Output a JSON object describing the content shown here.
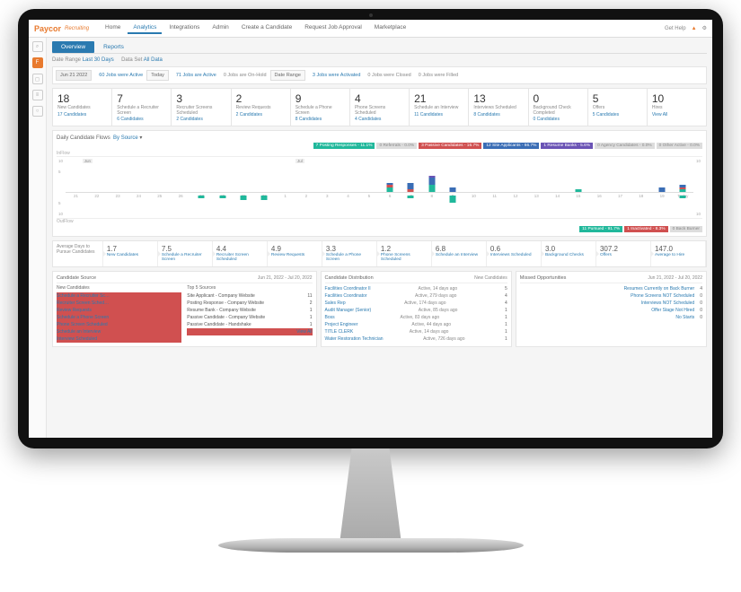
{
  "brand": {
    "name": "Paycor",
    "sub": "Recruiting"
  },
  "nav": [
    "Home",
    "Analytics",
    "Integrations",
    "Admin",
    "Create a Candidate",
    "Request Job Approval",
    "Marketplace"
  ],
  "nav_active": 1,
  "header_right": {
    "help": "Get Help"
  },
  "tabs": {
    "overview": "Overview",
    "reports": "Reports"
  },
  "filters": {
    "date_range_label": "Date Range",
    "date_range_value": "Last 30 Days",
    "data_set_label": "Data Set",
    "data_set_value": "All Data"
  },
  "date_row": {
    "date_btn": "Jun 21 2022",
    "stat1": "60 Jobs were Active",
    "today_btn": "Today",
    "stat2": "71 Jobs are Active",
    "stat3": "0 Jobs are On-Hold",
    "range_btn": "Date Range",
    "stat4": "3 Jobs were Activated",
    "stat5": "0 Jobs were Closed",
    "stat6": "0 Jobs were Filled"
  },
  "kpis": [
    {
      "n": "18",
      "l": "New Candidates",
      "s": "17 Candidates"
    },
    {
      "n": "7",
      "l": "Schedule a Recruiter Screen",
      "s": "6 Candidates"
    },
    {
      "n": "3",
      "l": "Recruiter Screens Scheduled",
      "s": "2 Candidates"
    },
    {
      "n": "2",
      "l": "Review Requests",
      "s": "2 Candidates"
    },
    {
      "n": "9",
      "l": "Schedule a Phone Screen",
      "s": "8 Candidates"
    },
    {
      "n": "4",
      "l": "Phone Screens Scheduled",
      "s": "4 Candidates"
    },
    {
      "n": "21",
      "l": "Schedule an Interview",
      "s": "11 Candidates"
    },
    {
      "n": "13",
      "l": "Interviews Scheduled",
      "s": "8 Candidates"
    },
    {
      "n": "0",
      "l": "Background Check Completed",
      "s": "0 Candidates"
    },
    {
      "n": "5",
      "l": "Offers",
      "s": "5 Candidates"
    },
    {
      "n": "10",
      "l": "Hires",
      "s": "View All"
    }
  ],
  "chart": {
    "title": "Daily Candidate Flows",
    "subtitle": "By Source",
    "inflow": "InFlow",
    "outflow": "OutFlow",
    "legend": [
      "7 Posting Responses - 11.1%",
      "0 Referrals - 0.0%",
      "3 Passive Candidates - 16.7%",
      "12 Site Applicants - 66.7%",
      "1 Resume Banks - 5.6%",
      "0 Agency Candidates - 0.0%",
      "0 Other Active - 0.0%"
    ],
    "legend2": [
      "11 Pursued - 91.7%",
      "1 Inactivated - 8.3%",
      "0 Back Burner"
    ],
    "y": [
      "10",
      "5",
      "5",
      "10"
    ],
    "months": [
      "Jun",
      "Jul"
    ]
  },
  "chart_data": {
    "type": "bar",
    "title": "Daily Candidate Flows",
    "x": [
      21,
      22,
      23,
      24,
      25,
      26,
      27,
      28,
      29,
      30,
      1,
      2,
      3,
      4,
      5,
      6,
      7,
      8,
      9,
      10,
      11,
      12,
      13,
      14,
      15,
      16,
      17,
      18,
      19,
      "Today"
    ],
    "ylim_inflow": [
      0,
      10
    ],
    "ylim_outflow": [
      0,
      -10
    ],
    "series_inflow": [
      {
        "name": "Posting Responses",
        "color": "#20b89b",
        "values": [
          0,
          0,
          0,
          0,
          0,
          0,
          0,
          0,
          0,
          0,
          0,
          0,
          0,
          0,
          0,
          2,
          0,
          3,
          0,
          0,
          0,
          0,
          0,
          0,
          1,
          0,
          0,
          0,
          0,
          1
        ]
      },
      {
        "name": "Passive Candidates",
        "color": "#d05050",
        "values": [
          0,
          0,
          0,
          0,
          0,
          0,
          0,
          0,
          0,
          0,
          0,
          0,
          0,
          0,
          0,
          1,
          1,
          0,
          0,
          0,
          0,
          0,
          0,
          0,
          0,
          0,
          0,
          0,
          0,
          1
        ]
      },
      {
        "name": "Site Applicants",
        "color": "#3a6db5",
        "values": [
          0,
          0,
          0,
          0,
          0,
          0,
          0,
          0,
          0,
          0,
          0,
          0,
          0,
          0,
          0,
          1,
          3,
          3,
          2,
          0,
          0,
          0,
          0,
          0,
          0,
          0,
          0,
          0,
          2,
          1
        ]
      },
      {
        "name": "Resume Banks",
        "color": "#6a53b5",
        "values": [
          0,
          0,
          0,
          0,
          0,
          0,
          0,
          0,
          0,
          0,
          0,
          0,
          0,
          0,
          0,
          0,
          0,
          1,
          0,
          0,
          0,
          0,
          0,
          0,
          0,
          0,
          0,
          0,
          0,
          0
        ]
      }
    ],
    "series_outflow": [
      {
        "name": "Pursued",
        "color": "#20b89b",
        "values": [
          0,
          0,
          0,
          0,
          0,
          0,
          -1,
          -1,
          -2,
          -2,
          0,
          0,
          0,
          0,
          0,
          0,
          -1,
          0,
          -3,
          0,
          0,
          0,
          0,
          0,
          0,
          0,
          0,
          0,
          0,
          -1
        ]
      },
      {
        "name": "Inactivated",
        "color": "#d05050",
        "values": [
          0,
          0,
          0,
          0,
          0,
          0,
          0,
          0,
          0,
          0,
          0,
          0,
          0,
          0,
          0,
          0,
          0,
          0,
          0,
          0,
          0,
          0,
          0,
          0,
          0,
          0,
          0,
          0,
          0,
          0
        ]
      }
    ]
  },
  "funnel": {
    "head": "Average Days to Pursue Candidates",
    "cells": [
      {
        "n": "1.7",
        "l": "New Candidates"
      },
      {
        "n": "7.5",
        "l": "Schedule a Recruiter Screen"
      },
      {
        "n": "4.4",
        "l": "Recruiter Screen Scheduled"
      },
      {
        "n": "4.9",
        "l": "Review Requests"
      },
      {
        "n": "3.3",
        "l": "Schedule a Phone Screen"
      },
      {
        "n": "1.2",
        "l": "Phone Screens Scheduled"
      },
      {
        "n": "6.8",
        "l": "Schedule an Interview"
      },
      {
        "n": "0.6",
        "l": "Interviews Scheduled"
      },
      {
        "n": "3.0",
        "l": "Background Checks"
      },
      {
        "n": "307.2",
        "l": "Offers"
      },
      {
        "n": "147.0",
        "l": "Average to Hire"
      }
    ]
  },
  "panels": {
    "date": "Jun 21, 2022 - Jul 20, 2022",
    "cs": {
      "title": "Candidate Source",
      "left_h": "New Candidates",
      "left": [
        "Schedule a Recruiter Sc…",
        "Recruiter Screen Sched…",
        "Review Requests",
        "Schedule a Phone Screen",
        "Phone Screen Scheduled",
        "Schedule an Interview",
        "Interview Scheduled"
      ],
      "right_h": "Top 5 Sources",
      "right": [
        {
          "l": "Site Applicant - Company Website",
          "v": "11"
        },
        {
          "l": "Posting Response - Company Website",
          "v": "2"
        },
        {
          "l": "Resume Bank - Company Website",
          "v": "1"
        },
        {
          "l": "Passive Candidate - Company Website",
          "v": "1"
        },
        {
          "l": "Passive Candidate - Handshake",
          "v": "1"
        }
      ],
      "viewall": "View All"
    },
    "cd": {
      "title": "Candidate Distribution",
      "sub": "New Candidates",
      "rows": [
        {
          "l": "Facilities Coordinator II",
          "t": "Active, 14 days ago",
          "v": "5"
        },
        {
          "l": "Facilities Coordinator",
          "t": "Active, 279 days ago",
          "v": "4"
        },
        {
          "l": "Sales Rep",
          "t": "Active, 174 days ago",
          "v": "4"
        },
        {
          "l": "Audit Manager (Senior)",
          "t": "Active, 85 days ago",
          "v": "1"
        },
        {
          "l": "Boss",
          "t": "Active, 83 days ago",
          "v": "1"
        },
        {
          "l": "Project Engineer",
          "t": "Active, 44 days ago",
          "v": "1"
        },
        {
          "l": "TITLE CLERK",
          "t": "Active, 14 days ago",
          "v": "1"
        },
        {
          "l": "Water Restoration Technician",
          "t": "Active, 726 days ago",
          "v": "1"
        }
      ]
    },
    "mo": {
      "title": "Missed Opportunities",
      "rows": [
        {
          "l": "Resumes Currently on Back Burner",
          "v": "4"
        },
        {
          "l": "Phone Screens NOT Scheduled",
          "v": "0"
        },
        {
          "l": "Interviews NOT Scheduled",
          "v": "0"
        },
        {
          "l": "Offer Stage Not Hired",
          "v": "0"
        },
        {
          "l": "No Starts",
          "v": "0"
        }
      ]
    }
  }
}
